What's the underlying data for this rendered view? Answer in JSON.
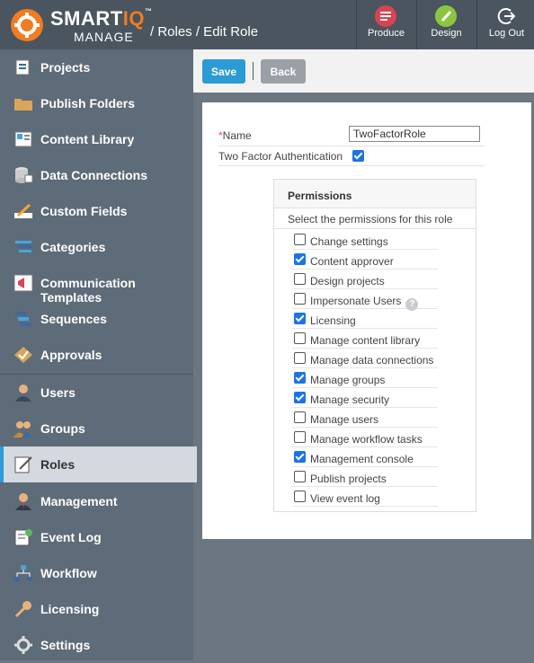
{
  "header": {
    "logo": {
      "smart": "SMART",
      "iq": "IQ",
      "tm": "™",
      "manage": "MANAGE"
    },
    "breadcrumb": "/ Roles / Edit Role",
    "buttons": [
      {
        "label": "Produce",
        "icon": "produce-icon",
        "color": "#d94452"
      },
      {
        "label": "Design",
        "icon": "design-icon",
        "color": "#8cc63f"
      },
      {
        "label": "Log Out",
        "icon": "logout-icon",
        "color": "#4a5560"
      }
    ]
  },
  "sidebar": {
    "items": [
      {
        "label": "Projects",
        "icon": "projects-icon"
      },
      {
        "label": "Publish Folders",
        "icon": "folder-icon"
      },
      {
        "label": "Content Library",
        "icon": "content-library-icon"
      },
      {
        "label": "Data Connections",
        "icon": "database-icon"
      },
      {
        "label": "Custom Fields",
        "icon": "pencil-icon"
      },
      {
        "label": "Categories",
        "icon": "categories-icon"
      },
      {
        "label": "Communication Templates",
        "icon": "megaphone-icon"
      },
      {
        "label": "Sequences",
        "icon": "sequences-icon"
      },
      {
        "label": "Approvals",
        "icon": "approvals-icon"
      },
      {
        "label": "Users",
        "icon": "user-icon"
      },
      {
        "label": "Groups",
        "icon": "group-icon"
      },
      {
        "label": "Roles",
        "icon": "roles-icon",
        "active": true
      },
      {
        "label": "Management",
        "icon": "management-icon"
      },
      {
        "label": "Event Log",
        "icon": "event-log-icon"
      },
      {
        "label": "Workflow",
        "icon": "workflow-icon"
      },
      {
        "label": "Licensing",
        "icon": "key-icon"
      },
      {
        "label": "Settings",
        "icon": "gear-icon"
      }
    ]
  },
  "toolbar": {
    "save_label": "Save",
    "back_label": "Back"
  },
  "form": {
    "name_label": "Name",
    "required_mark": "*",
    "name_value": "TwoFactorRole",
    "two_factor_label": "Two Factor Authentication",
    "two_factor_checked": true
  },
  "permissions": {
    "title": "Permissions",
    "subtitle": "Select the permissions for this role",
    "items": [
      {
        "label": "Change settings",
        "checked": false
      },
      {
        "label": "Content approver",
        "checked": true
      },
      {
        "label": "Design projects",
        "checked": false
      },
      {
        "label": "Impersonate Users",
        "checked": false,
        "help": "?"
      },
      {
        "label": "Licensing",
        "checked": true
      },
      {
        "label": "Manage content library",
        "checked": false
      },
      {
        "label": "Manage data connections",
        "checked": false
      },
      {
        "label": "Manage groups",
        "checked": true
      },
      {
        "label": "Manage security",
        "checked": true
      },
      {
        "label": "Manage users",
        "checked": false
      },
      {
        "label": "Manage workflow tasks",
        "checked": false
      },
      {
        "label": "Management console",
        "checked": true
      },
      {
        "label": "Publish projects",
        "checked": false
      },
      {
        "label": "View event log",
        "checked": false
      }
    ]
  }
}
